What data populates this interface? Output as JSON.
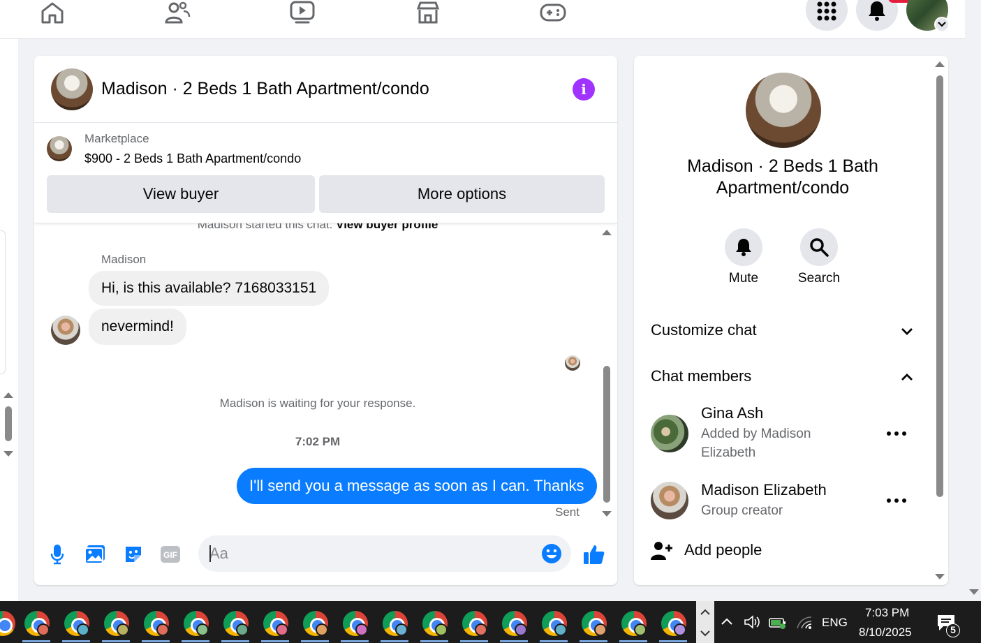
{
  "nav": {
    "icons": [
      "home-icon",
      "friends-icon",
      "watch-icon",
      "marketplace-icon",
      "gaming-icon",
      "menu-grid-icon",
      "notifications-icon",
      "profile-avatar"
    ]
  },
  "chat": {
    "title": "Madison · 2 Beds 1 Bath Apartment/condo",
    "marketplace_label": "Marketplace",
    "listing": "$900 - 2 Beds 1 Bath Apartment/condo",
    "view_buyer": "View buyer",
    "more_options": "More options",
    "started_text": "Madison started this chat.",
    "view_buyer_profile": "View buyer profile",
    "sender_name": "Madison",
    "messages_in": [
      "Hi, is this available? 7168033151",
      "nevermind!"
    ],
    "waiting": "Madison is waiting for your response.",
    "time": "7:02 PM",
    "message_out": "I'll send you a message as soon as I can. Thanks",
    "sent_label": "Sent",
    "input_placeholder": "Aa",
    "accent": "#0a7cff"
  },
  "info": {
    "title": "Madison · 2 Beds 1 Bath Apartment/condo",
    "mute": "Mute",
    "search": "Search",
    "customize": "Customize chat",
    "members_head": "Chat members",
    "members": [
      {
        "name": "Gina Ash",
        "sub": "Added by Madison Elizabeth"
      },
      {
        "name": "Madison Elizabeth",
        "sub": "Group creator"
      }
    ],
    "add_people": "Add people"
  },
  "taskbar": {
    "lang": "ENG",
    "time": "7:03 PM",
    "date": "8/10/2025",
    "notif_count": "5"
  }
}
